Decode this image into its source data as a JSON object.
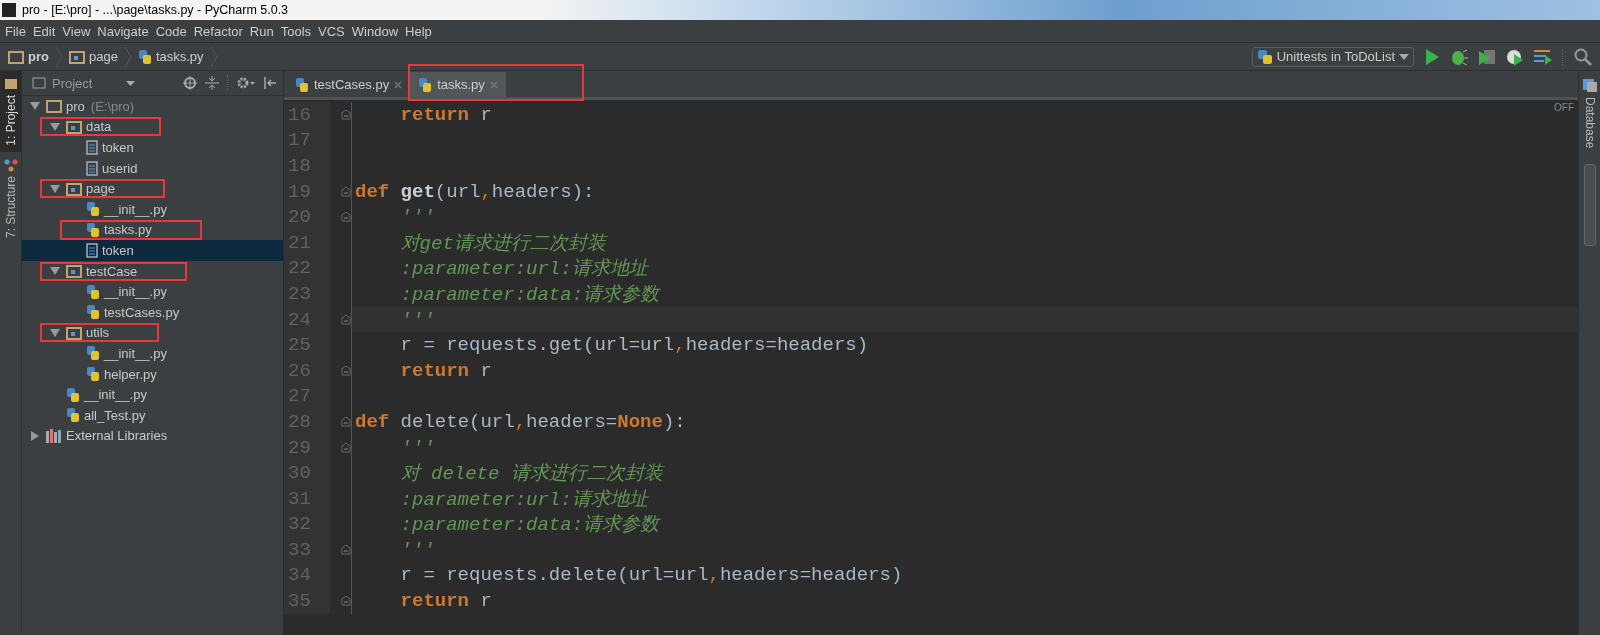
{
  "window": {
    "title": "pro - [E:\\pro] - ...\\page\\tasks.py - PyCharm 5.0.3"
  },
  "menu": [
    "File",
    "Edit",
    "View",
    "Navigate",
    "Code",
    "Refactor",
    "Run",
    "Tools",
    "VCS",
    "Window",
    "Help"
  ],
  "breadcrumbs": [
    {
      "label": "pro",
      "kind": "folder"
    },
    {
      "label": "page",
      "kind": "module"
    },
    {
      "label": "tasks.py",
      "kind": "python"
    }
  ],
  "run_config": {
    "label": "Unittests in ToDoList"
  },
  "side_tabs": [
    {
      "label": "1: Project",
      "selected": true
    },
    {
      "label": "7: Structure",
      "selected": false
    }
  ],
  "right_tabs": [
    {
      "label": "Database"
    }
  ],
  "project": {
    "title": "Project",
    "tree": [
      {
        "label": "pro",
        "hint": "(E:\\pro)",
        "kind": "folder",
        "expanded": true,
        "selected": false,
        "marked": false,
        "children": [
          {
            "label": "data",
            "kind": "module",
            "expanded": true,
            "selected": false,
            "marked": true,
            "children": [
              {
                "label": "token",
                "kind": "text",
                "selected": false,
                "marked": false
              },
              {
                "label": "userid",
                "kind": "text",
                "selected": false,
                "marked": false
              }
            ]
          },
          {
            "label": "page",
            "kind": "module",
            "expanded": true,
            "selected": false,
            "marked": true,
            "children": [
              {
                "label": "__init__.py",
                "kind": "python",
                "selected": false,
                "marked": false
              },
              {
                "label": "tasks.py",
                "kind": "python",
                "selected": false,
                "marked": true
              },
              {
                "label": "token",
                "kind": "text",
                "selected": true,
                "marked": false
              }
            ]
          },
          {
            "label": "testCase",
            "kind": "module",
            "expanded": true,
            "selected": false,
            "marked": true,
            "children": [
              {
                "label": "__init__.py",
                "kind": "python",
                "selected": false,
                "marked": false
              },
              {
                "label": "testCases.py",
                "kind": "python",
                "selected": false,
                "marked": false
              }
            ]
          },
          {
            "label": "utils",
            "kind": "module",
            "expanded": true,
            "selected": false,
            "marked": true,
            "children": [
              {
                "label": "__init__.py",
                "kind": "python",
                "selected": false,
                "marked": false
              },
              {
                "label": "helper.py",
                "kind": "python",
                "selected": false,
                "marked": false
              }
            ]
          },
          {
            "label": "__init__.py",
            "kind": "python",
            "selected": false,
            "marked": false
          },
          {
            "label": "all_Test.py",
            "kind": "python",
            "selected": false,
            "marked": false
          }
        ]
      },
      {
        "label": "External Libraries",
        "kind": "library",
        "expanded": false,
        "selected": false,
        "marked": false
      }
    ]
  },
  "editor": {
    "tabs": [
      {
        "label": "testCases.py",
        "selected": false,
        "marked": false
      },
      {
        "label": "tasks.py",
        "selected": true,
        "marked": true
      }
    ],
    "inspection": "OFF",
    "lines": [
      {
        "number": "16",
        "fold": true,
        "current": false,
        "tokens": [
          {
            "text": "    return",
            "kind": "keyword"
          },
          {
            "text": " r",
            "kind": "plain"
          }
        ]
      },
      {
        "number": "17",
        "fold": false,
        "current": false
      },
      {
        "number": "18",
        "fold": false,
        "current": false
      },
      {
        "number": "19",
        "fold": true,
        "current": false,
        "tokens": [
          {
            "text": "def ",
            "kind": "keyword"
          },
          {
            "text": "get",
            "kind": "name"
          },
          {
            "text": "(url",
            "kind": "plain"
          },
          {
            "text": ",",
            "kind": "comma"
          },
          {
            "text": "headers):",
            "kind": "plain"
          }
        ]
      },
      {
        "number": "20",
        "fold": true,
        "current": false,
        "tokens": [
          {
            "text": "    '''",
            "kind": "comment"
          }
        ]
      },
      {
        "number": "21",
        "fold": false,
        "current": false,
        "tokens": [
          {
            "text": "    对get请求进行二次封装",
            "kind": "comment"
          }
        ]
      },
      {
        "number": "22",
        "fold": false,
        "current": false,
        "tokens": [
          {
            "text": "    :parameter:url:请求地址",
            "kind": "comment"
          }
        ]
      },
      {
        "number": "23",
        "fold": false,
        "current": false,
        "tokens": [
          {
            "text": "    :parameter:data:请求参数",
            "kind": "comment"
          }
        ]
      },
      {
        "number": "24",
        "fold": true,
        "current": true,
        "tokens": [
          {
            "text": "    '''",
            "kind": "comment"
          }
        ]
      },
      {
        "number": "25",
        "fold": false,
        "current": false,
        "tokens": [
          {
            "text": "    r = requests.get(url=url",
            "kind": "plain"
          },
          {
            "text": ",",
            "kind": "comma"
          },
          {
            "text": "headers=headers)",
            "kind": "plain"
          }
        ]
      },
      {
        "number": "26",
        "fold": true,
        "current": false,
        "tokens": [
          {
            "text": "    return",
            "kind": "keyword"
          },
          {
            "text": " r",
            "kind": "plain"
          }
        ]
      },
      {
        "number": "27",
        "fold": false,
        "current": false
      },
      {
        "number": "28",
        "fold": true,
        "current": false,
        "tokens": [
          {
            "text": "def",
            "kind": "keyword"
          },
          {
            "text": " delete(url",
            "kind": "plain"
          },
          {
            "text": ",",
            "kind": "comma"
          },
          {
            "text": "headers=",
            "kind": "plain"
          },
          {
            "text": "None",
            "kind": "constant"
          },
          {
            "text": "):",
            "kind": "plain"
          }
        ]
      },
      {
        "number": "29",
        "fold": true,
        "current": false,
        "tokens": [
          {
            "text": "    '''",
            "kind": "comment"
          }
        ]
      },
      {
        "number": "30",
        "fold": false,
        "current": false,
        "tokens": [
          {
            "text": "    对 delete 请求进行二次封装",
            "kind": "comment"
          }
        ]
      },
      {
        "number": "31",
        "fold": false,
        "current": false,
        "tokens": [
          {
            "text": "    :parameter:url:请求地址",
            "kind": "comment"
          }
        ]
      },
      {
        "number": "32",
        "fold": false,
        "current": false,
        "tokens": [
          {
            "text": "    :parameter:data:请求参数",
            "kind": "comment"
          }
        ]
      },
      {
        "number": "33",
        "fold": true,
        "current": false,
        "tokens": [
          {
            "text": "    '''",
            "kind": "comment"
          }
        ]
      },
      {
        "number": "34",
        "fold": false,
        "current": false,
        "tokens": [
          {
            "text": "    r = requests.delete(url=url",
            "kind": "plain"
          },
          {
            "text": ",",
            "kind": "comma"
          },
          {
            "text": "headers=headers)",
            "kind": "plain"
          }
        ]
      },
      {
        "number": "35",
        "fold": true,
        "current": false,
        "tokens": [
          {
            "text": "    return",
            "kind": "keyword"
          },
          {
            "text": " r",
            "kind": "plain"
          }
        ]
      }
    ]
  }
}
